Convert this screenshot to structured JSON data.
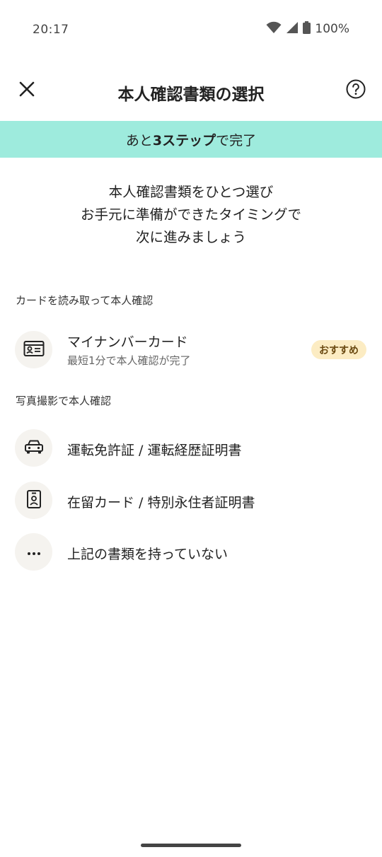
{
  "status_bar": {
    "time": "20:17",
    "battery": "100%",
    "icons": [
      "wifi-icon",
      "signal-icon",
      "battery-icon"
    ]
  },
  "header": {
    "title": "本人確認書類の選択",
    "close_icon": "close-icon",
    "help_icon": "help-icon"
  },
  "steps_banner": {
    "prefix": "あと",
    "highlight": "3ステップ",
    "suffix": "で完了",
    "color": "#9eebdd"
  },
  "intro": {
    "lines": [
      "本人確認書類をひとつ選び",
      "お手元に準備ができたタイミングで",
      "次に進みましょう"
    ]
  },
  "sections": {
    "card_reading": {
      "label": "カードを読み取って本人確認",
      "items": [
        {
          "title": "マイナンバーカード",
          "subtitle": "最短1分で本人確認が完了",
          "badge": "おすすめ",
          "icon": "id-card-icon"
        }
      ]
    },
    "photo": {
      "label": "写真撮影で本人確認",
      "items": [
        {
          "title": "運転免許証 / 運転経歴証明書",
          "icon": "car-icon"
        },
        {
          "title": "在留カード / 特別永住者証明書",
          "icon": "residence-card-icon"
        },
        {
          "title": "上記の書類を持っていない",
          "icon": "more-icon"
        }
      ]
    }
  }
}
